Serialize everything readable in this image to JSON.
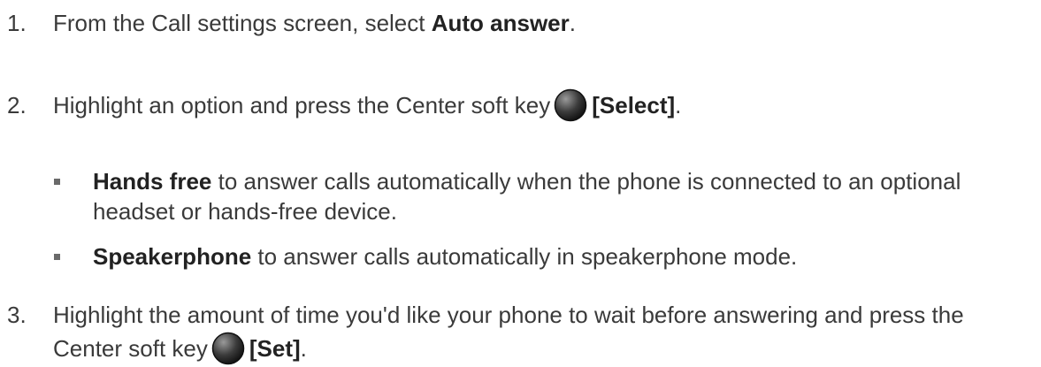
{
  "steps": [
    {
      "number": "1.",
      "text_before": "From the Call settings screen, select ",
      "bold": "Auto answer",
      "text_after": "."
    },
    {
      "number": "2.",
      "text_before": "Highlight an option and press the Center soft key",
      "icon": "center-soft-key-icon",
      "bold": "[Select]",
      "text_after": "."
    },
    {
      "number": "3.",
      "text_before": "Highlight the amount of time you'd like your phone to wait before answering and press the Center soft key",
      "icon": "center-soft-key-icon",
      "bold": "[Set]",
      "text_after": "."
    }
  ],
  "options": [
    {
      "bold": "Hands free",
      "text": " to answer calls automatically when the phone is connected to an optional headset or hands-free device."
    },
    {
      "bold": "Speakerphone",
      "text": " to answer calls automatically in speakerphone mode."
    }
  ],
  "colors": {
    "text": "#3a3a3a",
    "bold_text": "#222222",
    "key_dark": "#1a1a1a",
    "key_light": "#9a9a9a"
  }
}
